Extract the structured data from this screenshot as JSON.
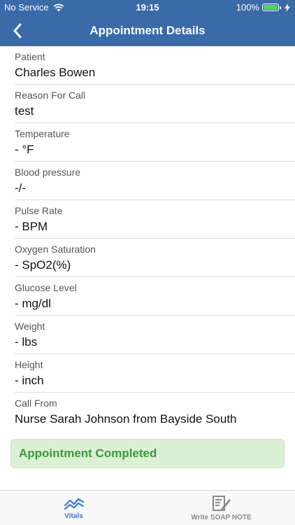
{
  "status_bar": {
    "carrier": "No Service",
    "time": "19:15",
    "battery": "100%",
    "wifi_icon": "wifi-icon",
    "charging_icon": "bolt-icon"
  },
  "nav": {
    "title": "Appointment Details",
    "back_icon": "chevron-left-icon"
  },
  "fields": [
    {
      "label": "Patient",
      "value": "Charles Bowen"
    },
    {
      "label": "Reason For Call",
      "value": "test"
    },
    {
      "label": "Temperature",
      "value": "- °F"
    },
    {
      "label": "Blood pressure",
      "value": "-/-"
    },
    {
      "label": "Pulse Rate",
      "value": "- BPM"
    },
    {
      "label": "Oxygen Saturation",
      "value": "- SpO2(%)"
    },
    {
      "label": "Glucose Level",
      "value": "- mg/dl"
    },
    {
      "label": "Weight",
      "value": "- lbs"
    },
    {
      "label": "Height",
      "value": "- inch"
    },
    {
      "label": "Call From",
      "value": "Nurse Sarah Johnson from Bayside South"
    }
  ],
  "banner": {
    "text": "Appointment Completed"
  },
  "tabs": [
    {
      "label": "Vitals",
      "icon": "chart-line-icon"
    },
    {
      "label": "Write SOAP NOTE",
      "icon": "note-pencil-icon"
    }
  ],
  "colors": {
    "header": "#3a6aa8",
    "active_tab": "#3a7ad8",
    "inactive_tab": "#8a8a8a",
    "banner_text": "#3a9a3a",
    "banner_bg": "#dcf0d4",
    "battery": "#4cd964"
  }
}
